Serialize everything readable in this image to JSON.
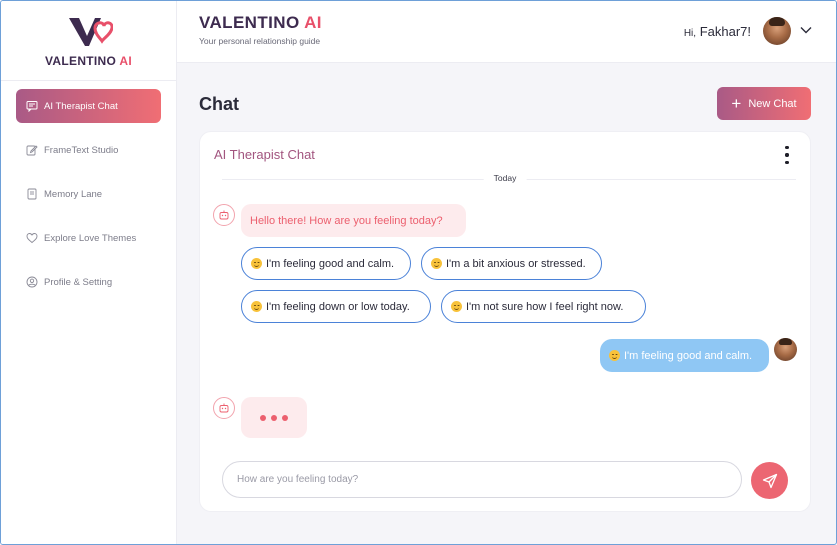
{
  "app": {
    "logo_text": "VALENTINO",
    "logo_ai": "AI",
    "brand_title": "VALENTINO",
    "brand_ai": "AI",
    "brand_subtitle": "Your personal relationship guide",
    "accent": "#e8506a",
    "accent_gradient": [
      "#a95a86",
      "#f06e74"
    ]
  },
  "sidebar": {
    "items": [
      {
        "label": "AI Therapist Chat",
        "icon": "chat-icon",
        "active": true
      },
      {
        "label": "FrameText Studio",
        "icon": "edit-icon",
        "active": false
      },
      {
        "label": "Memory Lane",
        "icon": "book-icon",
        "active": false
      },
      {
        "label": "Explore Love Themes",
        "icon": "heart-icon",
        "active": false
      },
      {
        "label": "Profile & Setting",
        "icon": "user-circle-icon",
        "active": false
      }
    ]
  },
  "header": {
    "greeting_hi": "Hi,",
    "greeting_name": "Fakhar7!",
    "dropdown_icon": "chevron-down-icon"
  },
  "main": {
    "page_title": "Chat",
    "new_chat_label": "New Chat",
    "chat": {
      "title": "AI Therapist Chat",
      "day_separator": "Today",
      "bot_message": "Hello there! How are you feeling today?",
      "options": [
        "I'm feeling good and calm.",
        "I'm a bit anxious or stressed.",
        "I'm feeling down or low today.",
        "I'm not sure how I feel right now."
      ],
      "user_message": "I'm feeling good and calm.",
      "input_placeholder": "How are you feeling today?",
      "send_icon": "send-icon"
    }
  }
}
